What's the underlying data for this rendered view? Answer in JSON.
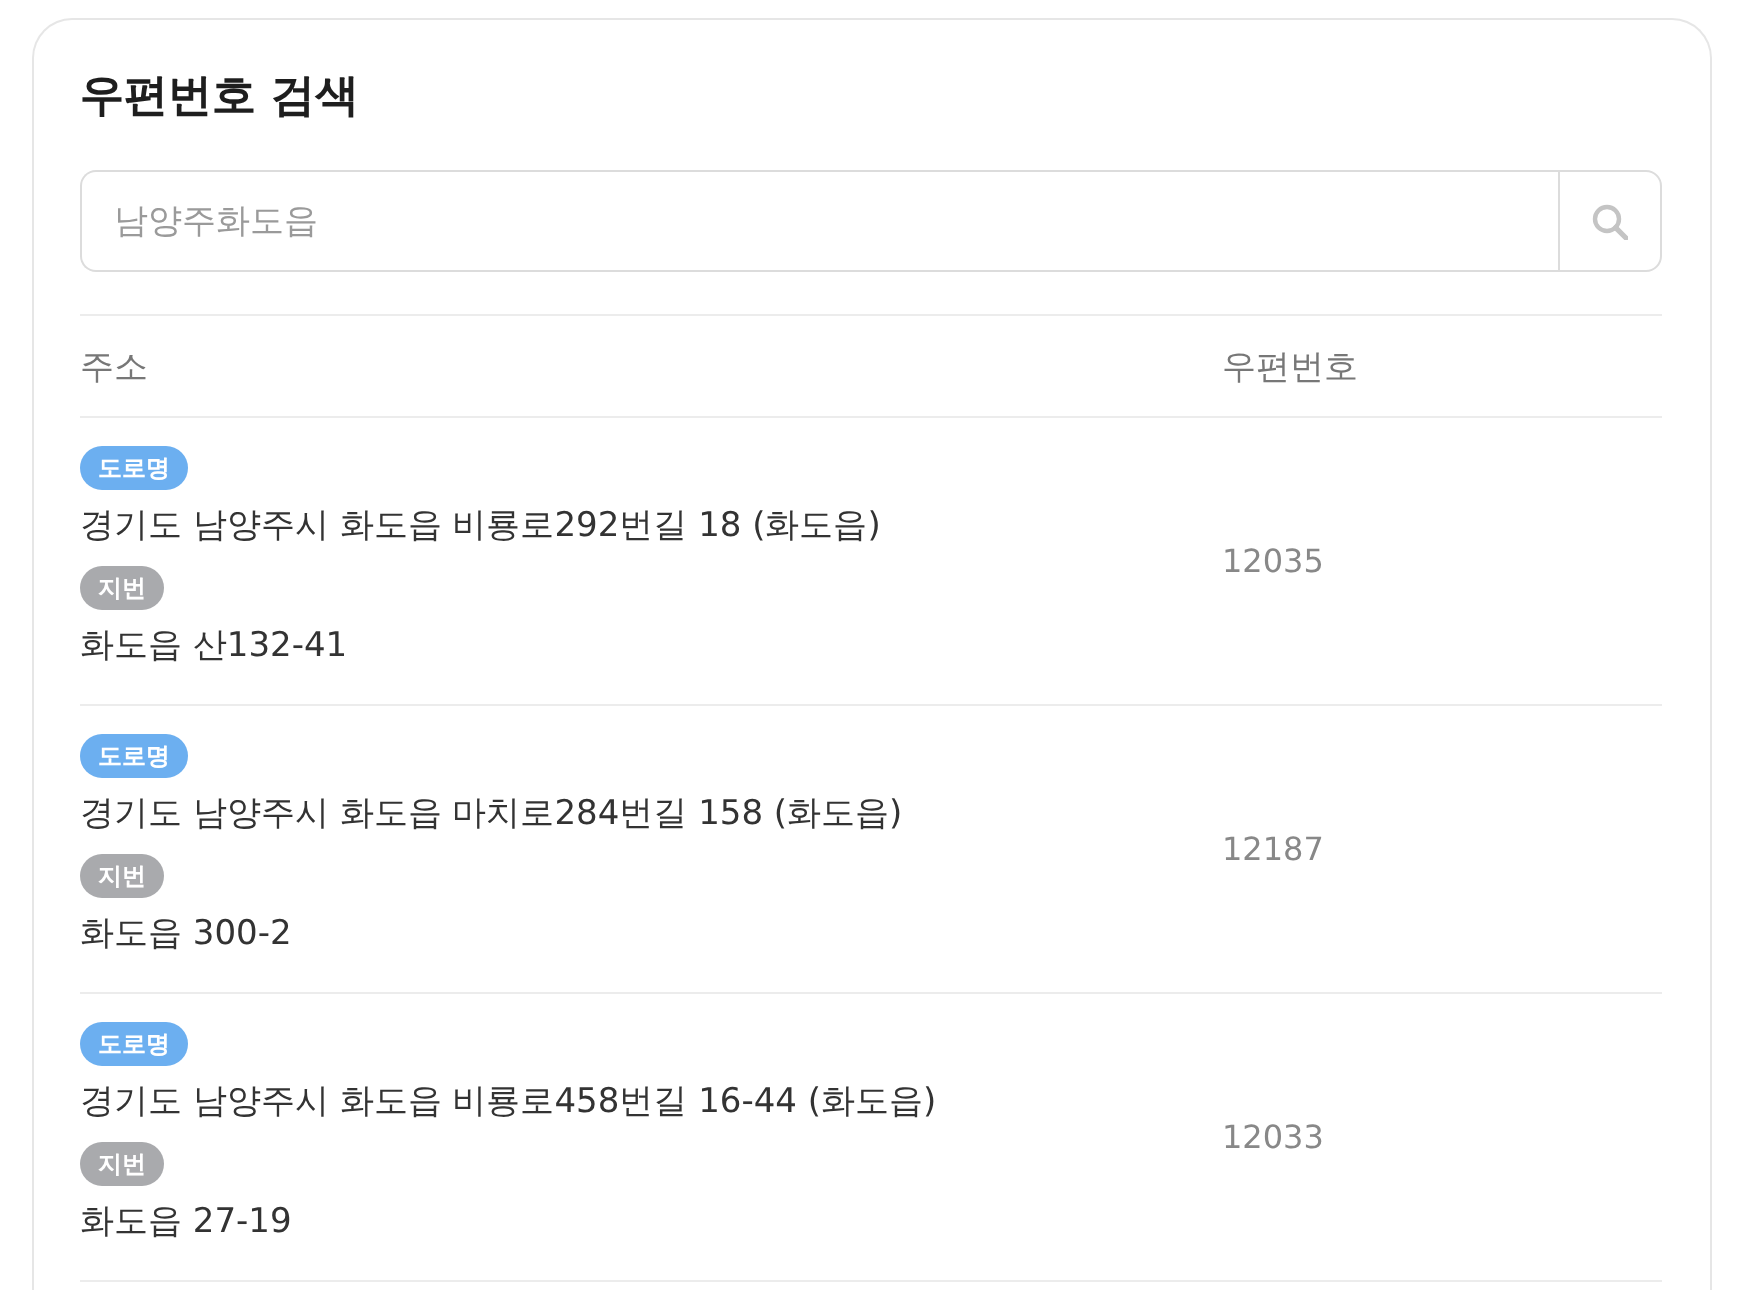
{
  "card": {
    "title": "우편번호 검색"
  },
  "search": {
    "placeholder": "남양주화도읍"
  },
  "table": {
    "columns": [
      "주소",
      "우편번호"
    ],
    "rows": [
      {
        "addresses": [
          {
            "tag": "도로명",
            "color": "#6caff0",
            "text": "경기도 남양주시 화도읍 비룡로292번길 18 (화도읍)"
          },
          {
            "tag": "지번",
            "color": "#a9aaad",
            "text": "화도읍 산132-41"
          }
        ],
        "postcode": "12035"
      },
      {
        "addresses": [
          {
            "tag": "도로명",
            "color": "#6caff0",
            "text": "경기도 남양주시 화도읍 마치로284번길 158 (화도읍)"
          },
          {
            "tag": "지번",
            "color": "#a9aaad",
            "text": "화도읍 300-2"
          }
        ],
        "postcode": "12187"
      },
      {
        "addresses": [
          {
            "tag": "도로명",
            "color": "#6caff0",
            "text": "경기도 남양주시 화도읍 비룡로458번길 16-44 (화도읍)"
          },
          {
            "tag": "지번",
            "color": "#a9aaad",
            "text": "화도읍 27-19"
          }
        ],
        "postcode": "12033"
      }
    ]
  }
}
